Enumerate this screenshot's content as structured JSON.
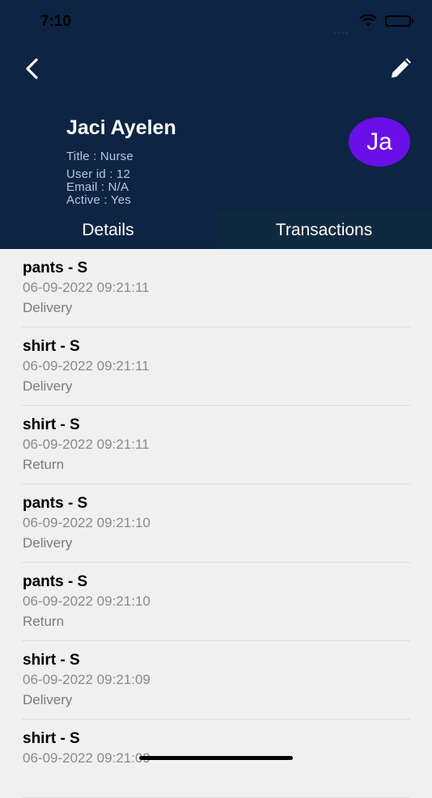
{
  "status_bar": {
    "time": "7:10"
  },
  "profile": {
    "name": "Jaci Ayelen",
    "title": "Title : Nurse",
    "user_id": "User id : 12",
    "email": "Email : N/A",
    "active": "Active : Yes",
    "avatar_initials": "Ja",
    "avatar_color": "#6a0fe8"
  },
  "tabs": [
    {
      "label": "Details",
      "selected": false
    },
    {
      "label": "Transactions",
      "selected": true
    }
  ],
  "transactions": [
    {
      "name": "pants - S",
      "date": "06-09-2022 09:21:11",
      "type": "Delivery"
    },
    {
      "name": "shirt - S",
      "date": "06-09-2022 09:21:11",
      "type": "Delivery"
    },
    {
      "name": "shirt - S",
      "date": "06-09-2022 09:21:11",
      "type": "Return"
    },
    {
      "name": "pants - S",
      "date": "06-09-2022 09:21:10",
      "type": "Delivery"
    },
    {
      "name": "pants - S",
      "date": "06-09-2022 09:21:10",
      "type": "Return"
    },
    {
      "name": "shirt - S",
      "date": "06-09-2022 09:21:09",
      "type": "Delivery"
    },
    {
      "name": "shirt - S",
      "date": "06-09-2022 09:21:09",
      "type": ""
    }
  ],
  "colors": {
    "header_bg": "#0d2444",
    "active_tab_bg": "#0f2a40",
    "list_bg": "#f0f0f0"
  }
}
